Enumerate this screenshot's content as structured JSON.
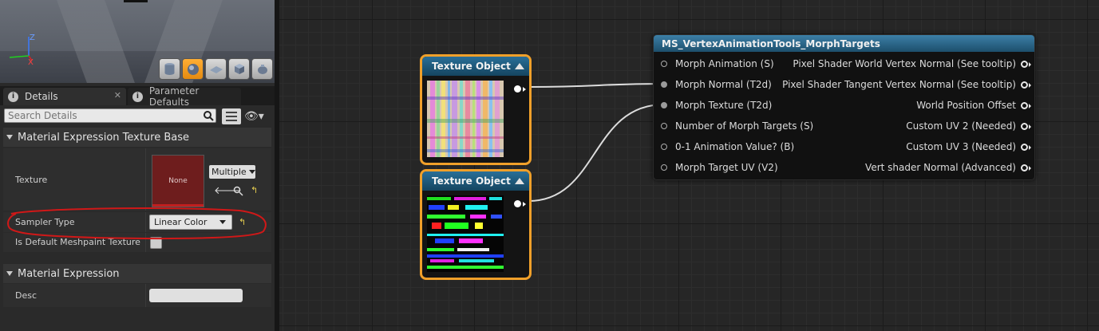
{
  "tabs": {
    "details": "Details",
    "parameter_defaults": "Parameter Defaults"
  },
  "search": {
    "placeholder": "Search Details"
  },
  "categories": {
    "texture_base": "Material Expression Texture Base",
    "expression": "Material Expression"
  },
  "properties": {
    "texture_label": "Texture",
    "texture_value": "None",
    "texture_dropdown": "Multiple",
    "sampler_type_label": "Sampler Type",
    "sampler_type_value": "Linear Color",
    "meshpaint_label": "Is Default Meshpaint Texture",
    "desc_label": "Desc",
    "desc_value": ""
  },
  "viewport": {
    "axis_z": "Z",
    "axis_x": "X"
  },
  "graph": {
    "texture_nodes": [
      {
        "title": "Texture Object"
      },
      {
        "title": "Texture Object"
      }
    ],
    "material_node": {
      "title": "MS_VertexAnimationTools_MorphTargets",
      "inputs": [
        "Morph Animation (S)",
        "Morph Normal (T2d)",
        "Morph Texture (T2d)",
        "Number of Morph Targets (S)",
        "0-1 Animation Value? (B)",
        "Morph Target UV (V2)"
      ],
      "outputs": [
        "Pixel Shader World Vertex Normal (See tooltip)",
        "Pixel Shader Tangent Vertex Normal (See tooltip)",
        "World Position Offset",
        "Custom UV 2 (Needed)",
        "Custom UV 3 (Needed)",
        "Vert shader Normal (Advanced)"
      ]
    }
  },
  "colors": {
    "node_selected": "#f0a02a",
    "annotation": "#d01818",
    "accent_orange": "#ffae35"
  }
}
